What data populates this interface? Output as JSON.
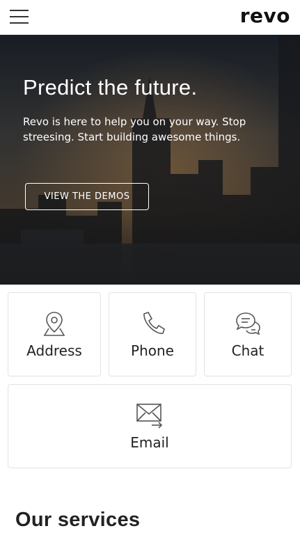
{
  "header": {
    "logo": "revo",
    "menu_icon": "hamburger-menu-icon"
  },
  "hero": {
    "title": "Predict the future.",
    "text": "Revo is here to help you on your way. Stop streesing. Start building awesome things.",
    "button_label": "VIEW THE DEMOS"
  },
  "contacts": [
    {
      "label": "Address",
      "icon": "map-pin-icon"
    },
    {
      "label": "Phone",
      "icon": "phone-icon"
    },
    {
      "label": "Chat",
      "icon": "chat-bubbles-icon"
    },
    {
      "label": "Email",
      "icon": "email-envelope-icon"
    }
  ],
  "services": {
    "title": "Our services"
  },
  "colors": {
    "text": "#222222",
    "icon": "#555555",
    "card_border": "#e2e2e2",
    "hero_text": "#ffffff"
  }
}
